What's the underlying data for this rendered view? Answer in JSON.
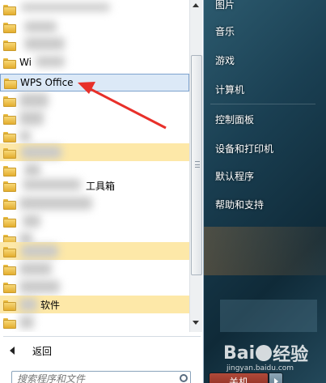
{
  "programs": {
    "items": [
      {
        "label": "",
        "blurred": true
      },
      {
        "label": "",
        "blurred": true
      },
      {
        "label": "",
        "blurred": true
      },
      {
        "label": "Wi",
        "blurred": true
      },
      {
        "label": "WPS Office",
        "blurred": false,
        "selected": true
      },
      {
        "label": "",
        "blurred": true
      },
      {
        "label": "",
        "blurred": true
      },
      {
        "label": "",
        "blurred": true
      },
      {
        "label": "",
        "blurred": true,
        "highlighted": true
      },
      {
        "label": "",
        "blurred": true
      },
      {
        "label": "工具箱",
        "blurred": false
      },
      {
        "label": "",
        "blurred": true
      },
      {
        "label": "",
        "blurred": true
      },
      {
        "label": "",
        "blurred": true
      },
      {
        "label": "",
        "blurred": true,
        "highlighted": true
      },
      {
        "label": "",
        "blurred": true
      },
      {
        "label": "",
        "blurred": true
      },
      {
        "label": "软件",
        "blurred": false,
        "highlighted": true
      },
      {
        "label": "",
        "blurred": true
      }
    ]
  },
  "back": {
    "label": "返回"
  },
  "search": {
    "placeholder": "搜索程序和文件"
  },
  "right_menu": [
    {
      "label": "图片"
    },
    {
      "label": "音乐"
    },
    {
      "label": "游戏"
    },
    {
      "label": "计算机"
    },
    {
      "label": "控制面板"
    },
    {
      "label": "设备和打印机"
    },
    {
      "label": "默认程序"
    },
    {
      "label": "帮助和支持"
    }
  ],
  "shutdown": {
    "label": "关机"
  },
  "watermark": {
    "brand": "Bai",
    "brand2": "经验",
    "url": "jingyan.baidu.com"
  },
  "colors": {
    "highlight": "#fde8a8",
    "selected": "#dce9f7",
    "arrow": "#e8302a"
  }
}
